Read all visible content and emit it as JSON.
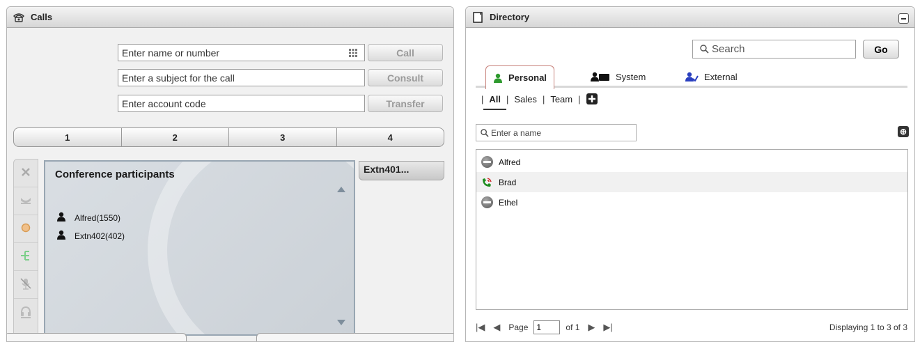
{
  "calls": {
    "title": "Calls",
    "name_placeholder": "Enter name or number",
    "subject_placeholder": "Enter a subject for the call",
    "account_placeholder": "Enter account code",
    "call_label": "Call",
    "consult_label": "Consult",
    "transfer_label": "Transfer",
    "lines": [
      "1",
      "2",
      "3",
      "4"
    ],
    "conference_title": "Conference participants",
    "participants": [
      "Alfred(1550)",
      "Extn402(402)"
    ],
    "active_tab": "Extn401..."
  },
  "directory": {
    "title": "Directory",
    "search_placeholder": "Search",
    "go_label": "Go",
    "tabs": [
      "Personal",
      "System",
      "External"
    ],
    "subtabs": [
      "All",
      "Sales",
      "Team"
    ],
    "filter_placeholder": "Enter a name",
    "contacts": [
      {
        "name": "Alfred",
        "status": "dnd"
      },
      {
        "name": "Brad",
        "status": "on-call"
      },
      {
        "name": "Ethel",
        "status": "dnd"
      }
    ],
    "pager": {
      "page_label": "Page",
      "page_value": "1",
      "of_label": "of 1",
      "displaying": "Displaying 1 to 3 of 3"
    }
  },
  "colors": {
    "personal_icon": "#2e9a2e",
    "external_icon": "#2a3fbf",
    "on_call_green": "#1f8c1f",
    "on_call_red": "#cc2222"
  }
}
